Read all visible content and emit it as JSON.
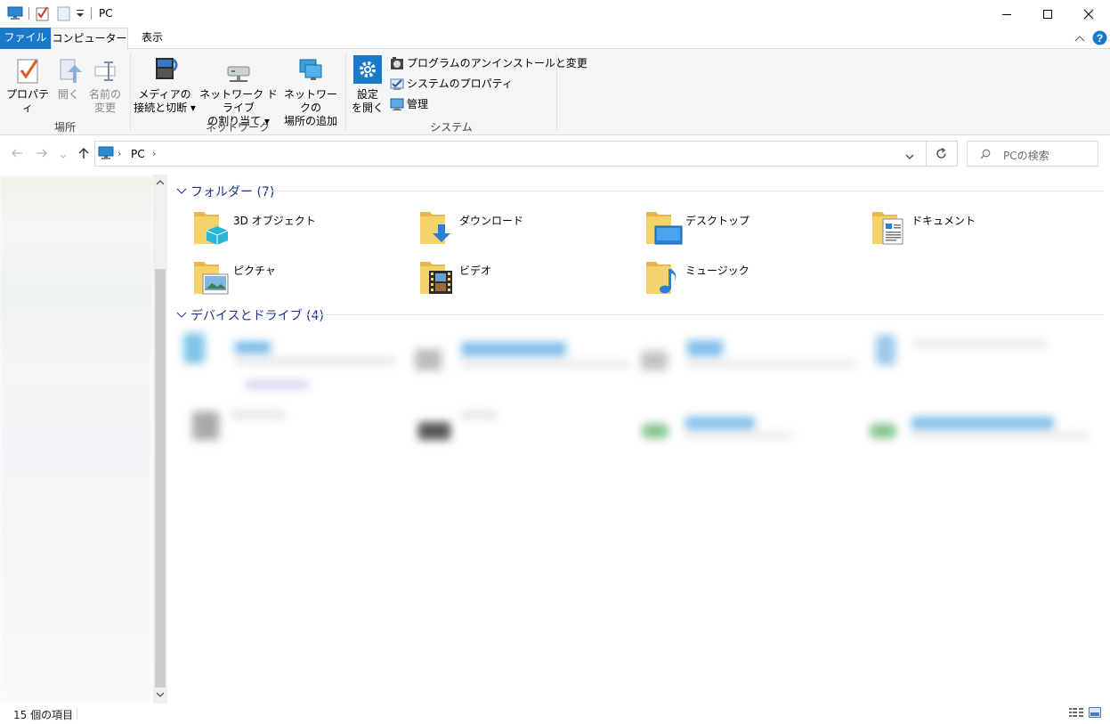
{
  "window": {
    "title": "PC",
    "qa_dropdown_icon": "dropdown-arrow-icon"
  },
  "ribbon_tabs": {
    "file": "ファイル",
    "computer": "コンピューター",
    "view": "表示"
  },
  "ribbon": {
    "location": {
      "label": "場所",
      "properties": "プロパティ",
      "open": "開く",
      "rename_l1": "名前の",
      "rename_l2": "変更"
    },
    "network": {
      "label": "ネットワーク",
      "media_l1": "メディアの",
      "media_l2": "接続と切断",
      "map_l1": "ネットワーク ドライブ",
      "map_l2": "の割り当て",
      "add_l1": "ネットワークの",
      "add_l2": "場所の追加"
    },
    "system": {
      "label": "システム",
      "settings_l1": "設定",
      "settings_l2": "を開く",
      "uninstall": "プログラムのアンインストールと変更",
      "sysprops": "システムのプロパティ",
      "manage": "管理"
    }
  },
  "address": {
    "path_item": "PC",
    "search_placeholder": "PCの検索"
  },
  "content": {
    "folders_header": "フォルダー (7)",
    "drives_header": "デバイスとドライブ (4)",
    "folders": [
      {
        "label": "3D オブジェクト",
        "icon": "3d-objects-folder-icon"
      },
      {
        "label": "ダウンロード",
        "icon": "downloads-folder-icon"
      },
      {
        "label": "デスクトップ",
        "icon": "desktop-folder-icon"
      },
      {
        "label": "ドキュメント",
        "icon": "documents-folder-icon"
      },
      {
        "label": "ピクチャ",
        "icon": "pictures-folder-icon"
      },
      {
        "label": "ビデオ",
        "icon": "videos-folder-icon"
      },
      {
        "label": "ミュージック",
        "icon": "music-folder-icon"
      }
    ]
  },
  "status": {
    "item_count": "15 個の項目"
  },
  "colors": {
    "accent": "#1979ca",
    "group_header": "#1e3287",
    "folder_yellow": "#f6d26b"
  }
}
